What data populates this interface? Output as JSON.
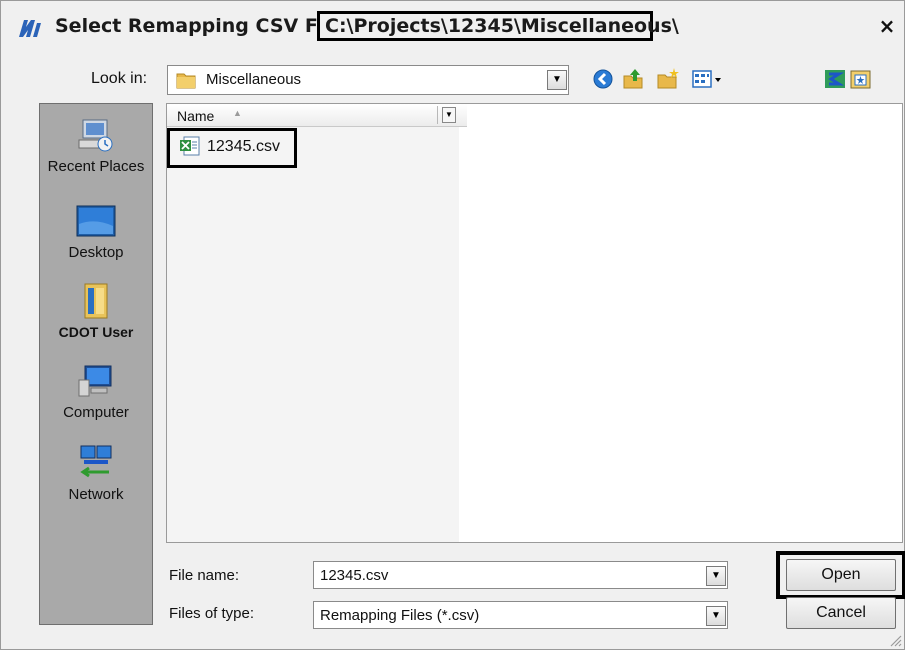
{
  "dialog": {
    "title": "Select Remapping CSV File -",
    "title_path": "C:\\Projects\\12345\\Miscellaneous\\",
    "close_label": "×"
  },
  "look_in": {
    "label": "Look in:",
    "value": "Miscellaneous"
  },
  "toolbar": {
    "icons": [
      "back-icon",
      "up-folder-icon",
      "new-folder-icon",
      "views-menu-icon",
      "network-icon",
      "favorites-icon"
    ]
  },
  "places": [
    {
      "label": "Recent Places",
      "icon": "recent-places-icon"
    },
    {
      "label": "Desktop",
      "icon": "desktop-icon"
    },
    {
      "label": "CDOT User",
      "icon": "user-folder-icon"
    },
    {
      "label": "Computer",
      "icon": "computer-icon"
    },
    {
      "label": "Network",
      "icon": "network-icon"
    }
  ],
  "file_list": {
    "column_name": "Name",
    "files": [
      {
        "name": "12345.csv",
        "icon": "csv-file-icon"
      }
    ]
  },
  "file_name": {
    "label": "File name:",
    "value": "12345.csv"
  },
  "file_type": {
    "label": "Files of type:",
    "value": "Remapping Files (*.csv)"
  },
  "buttons": {
    "open": "Open",
    "cancel": "Cancel"
  },
  "colors": {
    "dialog_bg": "#f0f0f0",
    "places_bg": "#a9a9a9",
    "highlight_box": "#000000"
  }
}
